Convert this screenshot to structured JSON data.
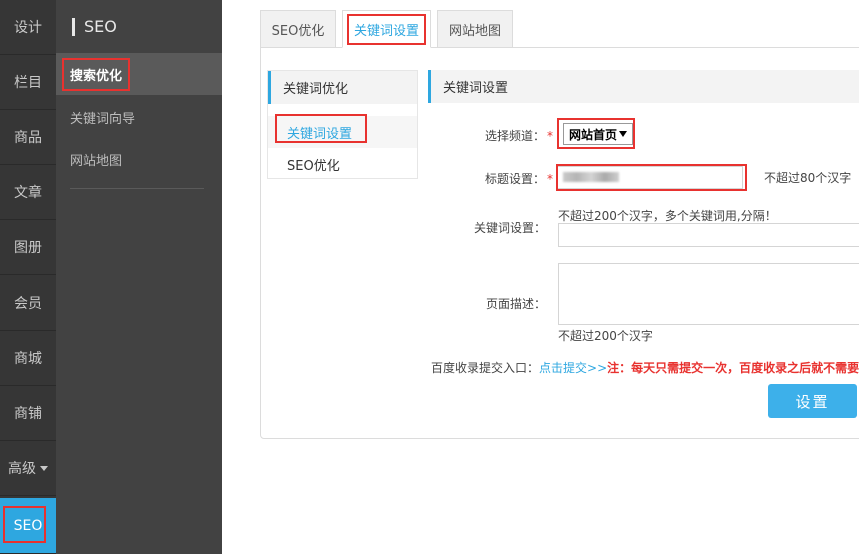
{
  "rail": {
    "items": [
      "设计",
      "栏目",
      "商品",
      "文章",
      "图册",
      "会员",
      "商城",
      "商铺",
      "高级",
      "SEO"
    ],
    "active_index": 9
  },
  "sidebar": {
    "title": "SEO",
    "items": [
      "搜索优化",
      "关键词向导",
      "网站地图"
    ],
    "active_index": 0
  },
  "tabs": [
    "SEO优化",
    "关键词设置",
    "网站地图"
  ],
  "active_tab": 1,
  "subnav": {
    "header": "关键词优化",
    "items": [
      "关键词设置",
      "SEO优化"
    ]
  },
  "form": {
    "header": "关键词设置",
    "channel_label": "选择频道：",
    "channel_value": "网站首页",
    "title_label": "标题设置：",
    "title_hint": "不超过80个汉字",
    "keywords_label": "关键词设置：",
    "keywords_hint": "不超过200个汉字，多个关键词用,分隔！",
    "desc_label": "页面描述：",
    "desc_hint": "不超过200个汉字",
    "baidu_label": "百度收录提交入口：",
    "baidu_link": "点击提交>>",
    "baidu_note": "注：每天只需提交一次，百度收录之后就不需要重复提交了",
    "submit_label": "设置"
  },
  "colors": {
    "accent": "#2ea7e0",
    "highlight": "#e8322f",
    "rail_bg": "#363636",
    "sidebar_bg": "#424242"
  }
}
